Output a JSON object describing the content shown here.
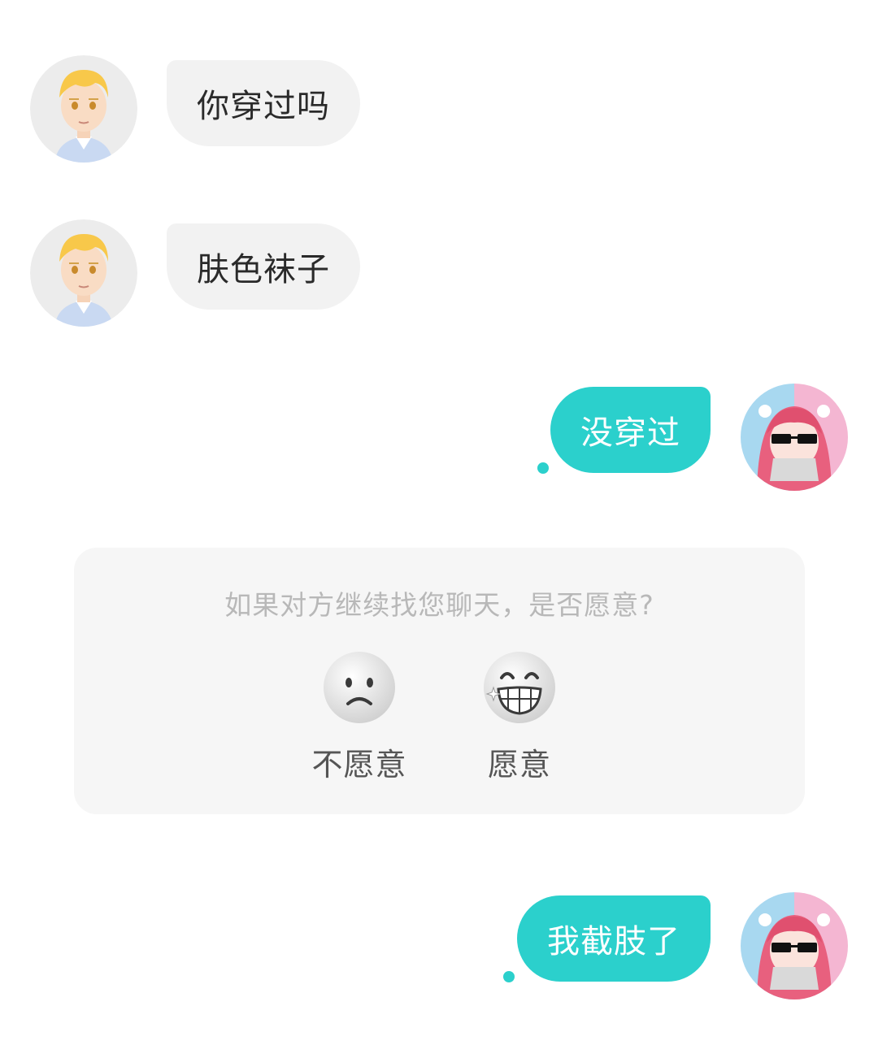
{
  "messages": [
    {
      "side": "left",
      "text": "你穿过吗"
    },
    {
      "side": "left",
      "text": "肤色袜子"
    },
    {
      "side": "right",
      "text": "没穿过"
    },
    {
      "side": "right",
      "text": "我截肢了"
    }
  ],
  "survey": {
    "question": "如果对方继续找您聊天，是否愿意?",
    "options": [
      {
        "label": "不愿意",
        "icon": "frowning-face-icon"
      },
      {
        "label": "愿意",
        "icon": "grinning-face-icon"
      }
    ]
  },
  "colors": {
    "accent": "#2bd0cc",
    "left_bubble": "#f2f2f2",
    "survey_bg": "#f6f6f6"
  }
}
